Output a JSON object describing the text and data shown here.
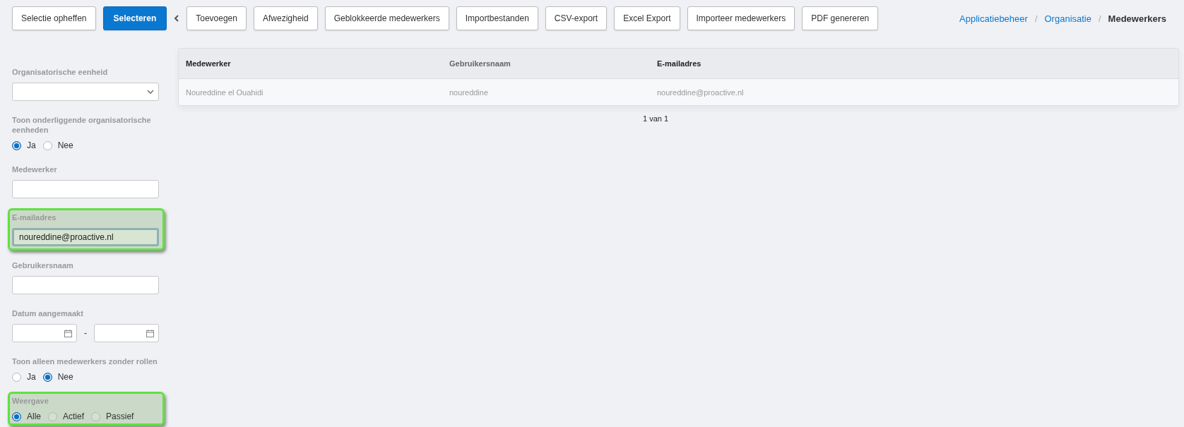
{
  "toolbar": {
    "buttons": [
      {
        "label": "Selectie opheffen",
        "kind": "default"
      },
      {
        "label": "Selecteren",
        "kind": "primary"
      },
      {
        "label": "Toevoegen",
        "kind": "default"
      },
      {
        "label": "Afwezigheid",
        "kind": "default"
      },
      {
        "label": "Geblokkeerde medewerkers",
        "kind": "default"
      },
      {
        "label": "Importbestanden",
        "kind": "default"
      },
      {
        "label": "CSV-export",
        "kind": "default"
      },
      {
        "label": "Excel Export",
        "kind": "default"
      },
      {
        "label": "Importeer medewerkers",
        "kind": "default"
      },
      {
        "label": "PDF genereren",
        "kind": "default"
      }
    ]
  },
  "breadcrumb": [
    {
      "label": "Applicatiebeheer",
      "current": false
    },
    {
      "label": "Organisatie",
      "current": false
    },
    {
      "label": "Medewerkers",
      "current": true
    }
  ],
  "breadcrumb_separator": "/",
  "filters": [
    {
      "kind": "select",
      "label": "Organisatorische eenheid",
      "highlighted": false
    },
    {
      "kind": "radio",
      "label": "Toon onderliggende organisatorische eenheden",
      "highlighted": false,
      "options": [
        {
          "label": "Ja",
          "selected": true
        },
        {
          "label": "Nee",
          "selected": false
        }
      ]
    },
    {
      "kind": "text",
      "label": "Medewerker",
      "highlighted": false
    },
    {
      "kind": "text",
      "label": "E-mailadres",
      "value": "noureddine@proactive.nl",
      "highlighted": true
    },
    {
      "kind": "text",
      "label": "Gebruikersnaam",
      "highlighted": false
    },
    {
      "kind": "daterange",
      "label": "Datum aangemaakt",
      "separator": "-",
      "highlighted": false
    },
    {
      "kind": "radio",
      "label": "Toon alleen medewerkers zonder rollen",
      "highlighted": false,
      "options": [
        {
          "label": "Ja",
          "selected": false
        },
        {
          "label": "Nee",
          "selected": true
        }
      ]
    },
    {
      "kind": "radio",
      "label": "Weergave",
      "highlighted": true,
      "options": [
        {
          "label": "Alle",
          "selected": true
        },
        {
          "label": "Actief",
          "selected": false
        },
        {
          "label": "Passief",
          "selected": false
        }
      ]
    }
  ],
  "table": {
    "columns": [
      "Medewerker",
      "Gebruikersnaam",
      "E-mailadres"
    ],
    "rows": [
      [
        "Noureddine el Ouahidi",
        "noureddine",
        "noureddine@proactive.nl"
      ]
    ],
    "pagination": "1 van 1"
  }
}
